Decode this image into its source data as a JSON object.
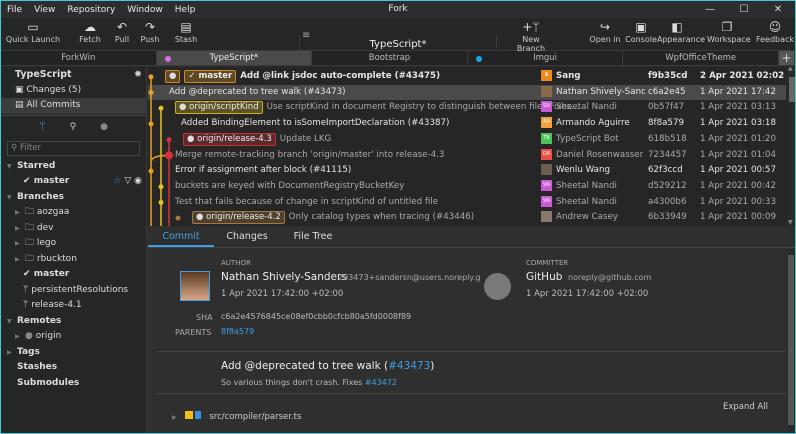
{
  "window": {
    "title": "Fork",
    "controls": [
      "—",
      "☐",
      "✕"
    ]
  },
  "menu": [
    "File",
    "View",
    "Repository",
    "Window",
    "Help"
  ],
  "toolbar": {
    "left": [
      {
        "label": "Quick Launch",
        "icon": "folder-icon"
      },
      {
        "label": "Fetch",
        "icon": "fetch-icon"
      },
      {
        "label": "Pull",
        "icon": "pull-icon"
      },
      {
        "label": "Push",
        "icon": "push-icon"
      },
      {
        "label": "Stash",
        "icon": "stash-icon"
      }
    ],
    "repo": {
      "name": "TypeScript*",
      "branch": "master"
    },
    "right": [
      {
        "label": "New Branch",
        "icon": "new-branch-icon"
      },
      {
        "label": "Open in",
        "icon": "open-in-icon"
      },
      {
        "label": "Console",
        "icon": "console-icon"
      },
      {
        "label": "Appearance",
        "icon": "appearance-icon"
      },
      {
        "label": "Workspace",
        "icon": "workspace-icon"
      },
      {
        "label": "Feedback",
        "icon": "smiley-icon"
      }
    ]
  },
  "tabs": [
    {
      "label": "ForkWin",
      "dot": null
    },
    {
      "label": "TypeScript*",
      "dot": "#d86ee8",
      "active": true
    },
    {
      "label": "Bootstrap",
      "dot": null
    },
    {
      "label": "Imgui",
      "dot": "#1aa3f0"
    },
    {
      "label": "WpfOfficeTheme",
      "dot": null
    }
  ],
  "sidebar": {
    "repo": "TypeScript",
    "changes": "Changes (5)",
    "all_commits": "All Commits",
    "filter_placeholder": "Filter",
    "starred": "Starred",
    "starred_items": [
      "master"
    ],
    "branches": "Branches",
    "branch_folders": [
      "aozgaa",
      "dev",
      "lego",
      "rbuckton"
    ],
    "branch_items": [
      "master",
      "persistentResolutions",
      "release-4.1"
    ],
    "remotes": "Remotes",
    "remote_items": [
      "origin"
    ],
    "tags": "Tags",
    "stashes": "Stashes",
    "submodules": "Submodules"
  },
  "commits": [
    {
      "badges": [
        {
          "text": "",
          "kind": "gh",
          "color": "#d08a22"
        },
        {
          "text": "✓ master",
          "color": "#d08a22"
        }
      ],
      "message": "Add @link jsdoc auto-complete (#43475)",
      "author": "Sang",
      "avatar": "S",
      "avatar_color": "#f08a1a",
      "sha": "f9b35cd",
      "date": "2 Apr 2021 02:02",
      "bold": true
    },
    {
      "badges": [],
      "message": "Add @deprecated to tree walk (#43473)",
      "author": "Nathan Shively-Sanders",
      "avatar": "",
      "avatar_color": "#8a6a4a",
      "sha": "c6a2e45",
      "date": "1 Apr 2021 17:42",
      "selected": true
    },
    {
      "badges": [
        {
          "text": "origin/scriptKind",
          "kind": "gh",
          "color": "#c8b020"
        }
      ],
      "message": "Use scriptKind in document Registry to distinguish between files Fixes...",
      "author": "Sheetal Nandi",
      "avatar": "SN",
      "avatar_color": "#c95bd6",
      "sha": "0b57f47",
      "date": "1 Apr 2021 03:13",
      "dim": true
    },
    {
      "badges": [],
      "message": "Added BindingElement to isSomeImportDeclaration (#43387)",
      "author": "Armando Aguirre",
      "avatar": "AA",
      "avatar_color": "#f0a040",
      "sha": "8f8a579",
      "date": "1 Apr 2021 03:18"
    },
    {
      "badges": [
        {
          "text": "origin/release-4.3",
          "kind": "gh",
          "color": "#c8303a"
        }
      ],
      "message": "Update LKG",
      "author": "TypeScript Bot",
      "avatar": "TB",
      "avatar_color": "#4fc35a",
      "sha": "618b518",
      "date": "1 Apr 2021 01:20",
      "dim": true
    },
    {
      "badges": [],
      "message": "Merge remote-tracking branch 'origin/master' into release-4.3",
      "author": "Daniel Rosenwasser",
      "avatar": "DR",
      "avatar_color": "#e8504a",
      "sha": "7234457",
      "date": "1 Apr 2021 01:04",
      "dim": true
    },
    {
      "badges": [],
      "message": "Error if assignment after block (#41115)",
      "author": "Wenlu Wang",
      "avatar": "",
      "avatar_color": "#6a6050",
      "sha": "62f3ccd",
      "date": "1 Apr 2021 00:57"
    },
    {
      "badges": [],
      "message": "buckets are keyed with DocumentRegistryBucketKey",
      "author": "Sheetal Nandi",
      "avatar": "SN",
      "avatar_color": "#c95bd6",
      "sha": "d529212",
      "date": "1 Apr 2021 00:42",
      "dim": true
    },
    {
      "badges": [],
      "message": "Test that fails because of change in scriptKind of untitled file",
      "author": "Sheetal Nandi",
      "avatar": "SN",
      "avatar_color": "#c95bd6",
      "sha": "a4300b6",
      "date": "1 Apr 2021 00:33",
      "dim": true
    },
    {
      "badges": [
        {
          "text": "origin/release-4.2",
          "kind": "gh",
          "color": "#a07a40"
        }
      ],
      "message": "Only catalog types when tracing (#43446)",
      "author": "Andrew Casey",
      "avatar": "",
      "avatar_color": "#8a7a6a",
      "sha": "6b33949",
      "date": "1 Apr 2021 00:09",
      "dim": true
    }
  ],
  "details": {
    "tabs": [
      "Commit",
      "Changes",
      "File Tree"
    ],
    "author_label": "AUTHOR",
    "author_name": "Nathan Shively-Sanders",
    "author_email": "293473+sandersn@users.noreply.githu",
    "author_date": "1 Apr 2021 17:42:00 +02:00",
    "committer_label": "COMMITTER",
    "committer_name": "GitHub",
    "committer_email": "noreply@github.com",
    "committer_date": "1 Apr 2021 17:42:00 +02:00",
    "sha_label": "SHA",
    "sha": "c6a2e4576845ce08ef0cbb0cfcb80a5fd0008f89",
    "parents_label": "PARENTS",
    "parent": "8f8a579",
    "subject": "Add @deprecated to tree walk (",
    "subject_link": "#43473",
    "subject_end": ")",
    "body": "So various things don't crash. Fixes ",
    "body_link": "#43472",
    "expand_all": "Expand All",
    "file": "src/compiler/parser.ts"
  },
  "colors": {
    "accent": "#3ea0e4",
    "border": "#4cc9d6"
  }
}
